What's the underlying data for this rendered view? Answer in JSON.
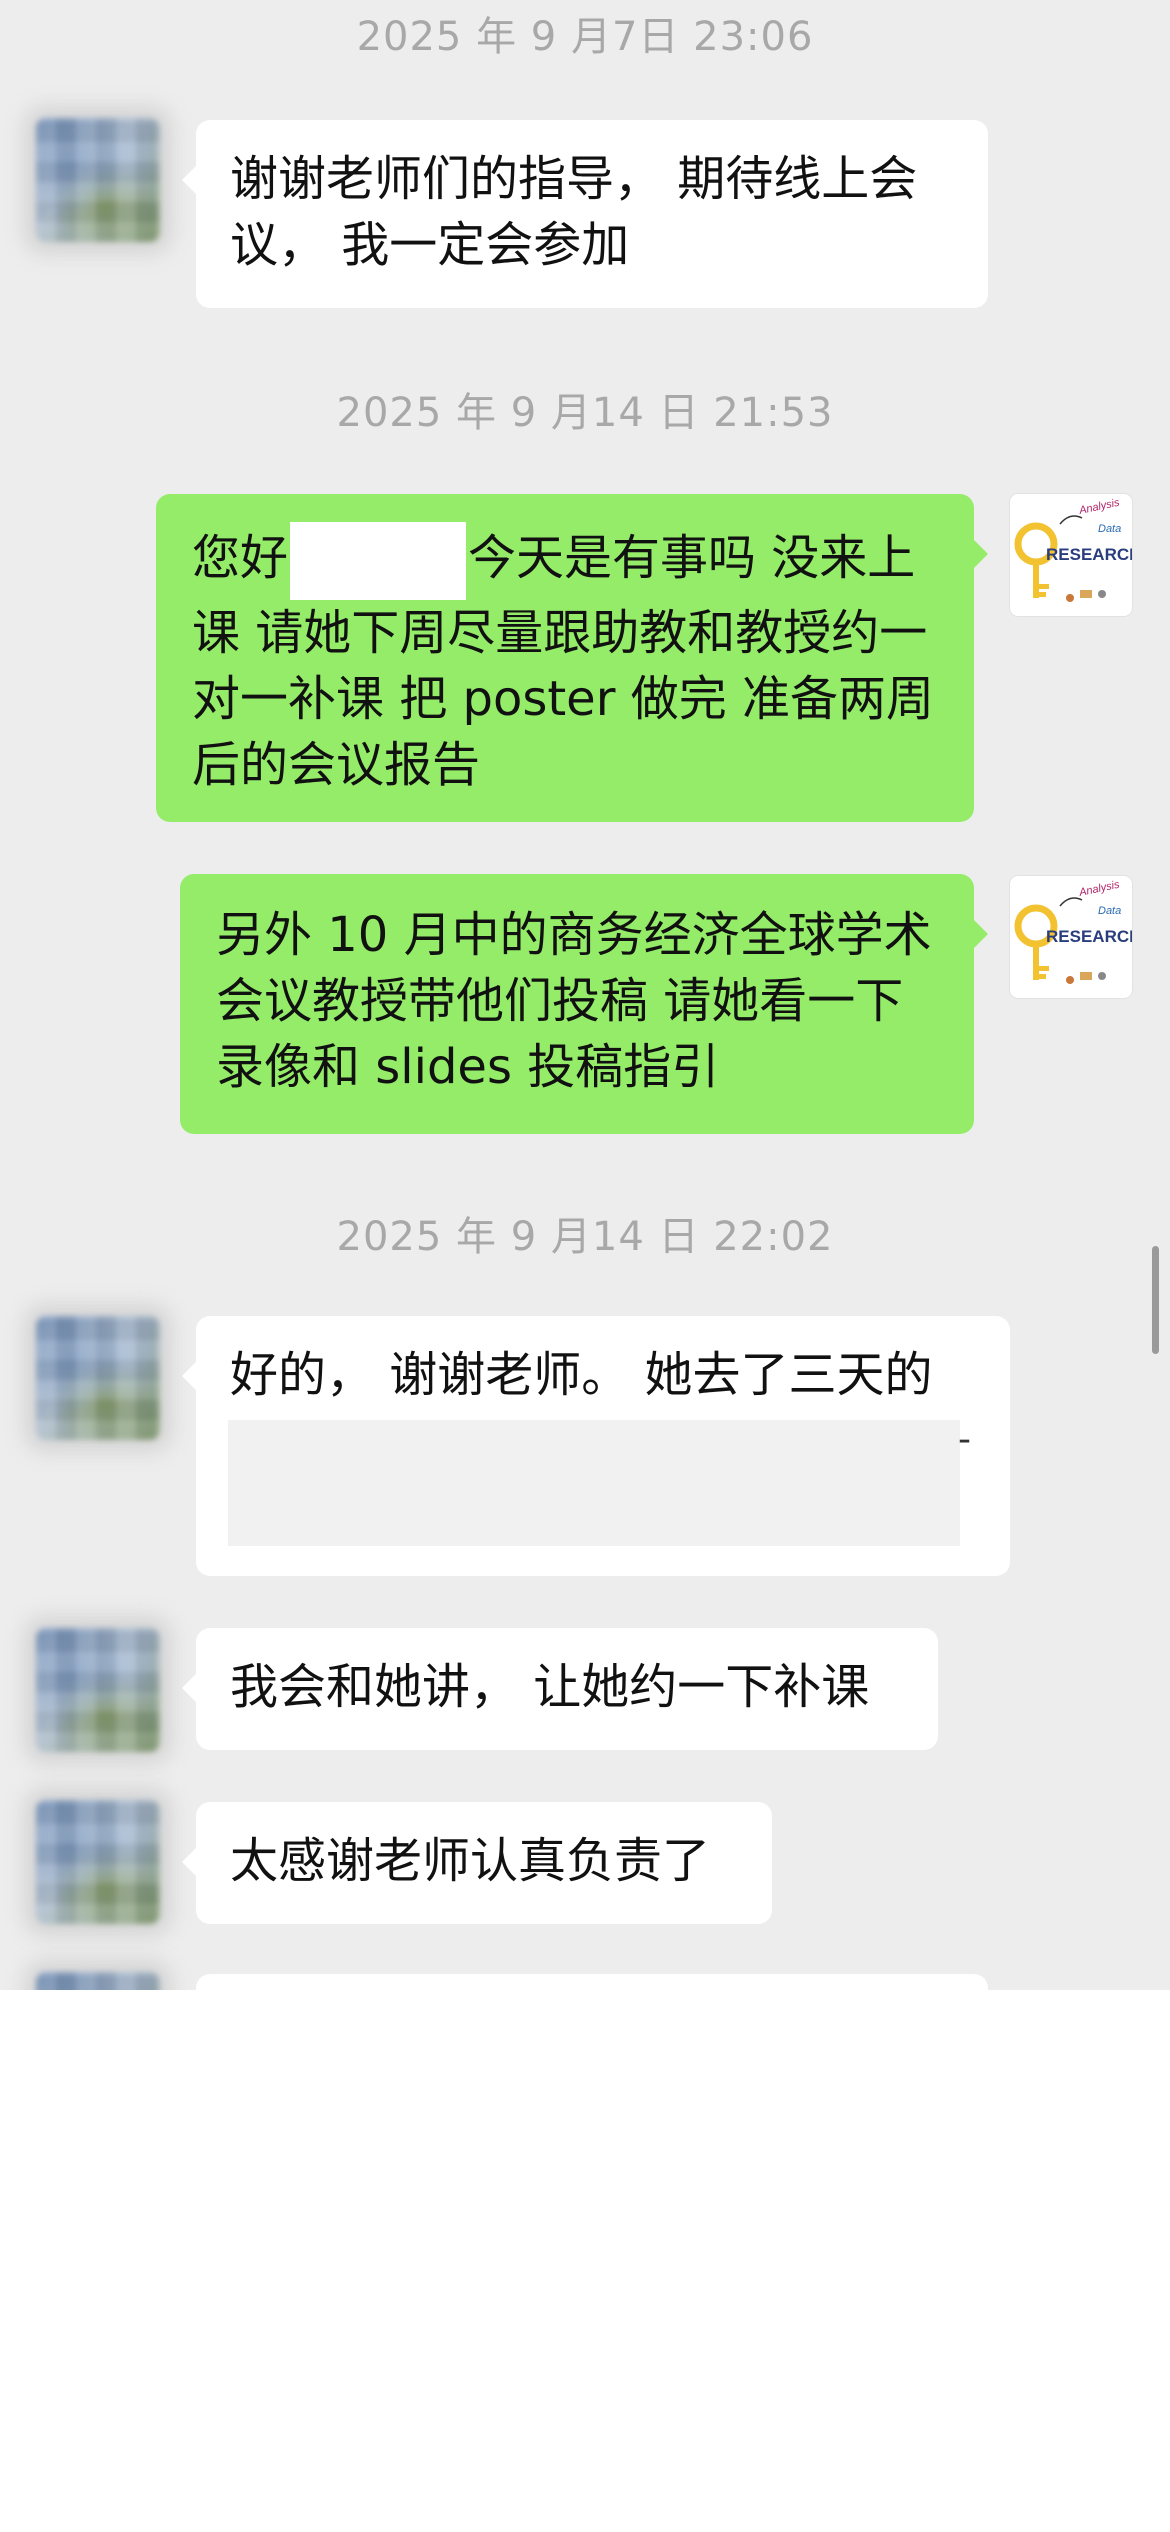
{
  "timestamps": [
    "2025 年 9 月7日 23:06",
    "2025 年 9 月14 日 21:53",
    "2025 年 9 月14 日 22:02"
  ],
  "messages": {
    "m1": "谢谢老师们的指导， 期待线上会议， 我一定会参加",
    "m2_prefix": "您好",
    "m2_rest": "今天是有事吗 没来上课 请她下周尽量跟助教和教授约一对一补课 把 poster 做完 准备两周后的会议报告",
    "m3": "另外 10 月中的商务经济全球学术会议教授带他们投稿 请她看一下录像和 slides 投稿指引",
    "m4": "好的， 谢谢老师。 她去了三天的",
    "m4_trail": "-",
    "m5": "我会和她讲， 让她约一下补课",
    "m6": "太感谢老师认真负责了"
  },
  "research_avatar": {
    "main_text": "RESEARCH",
    "tag1": "Analysis",
    "tag2": "Data"
  },
  "colors": {
    "chat_background": "#ededed",
    "incoming_bubble": "#ffffff",
    "outgoing_bubble": "#95ec69",
    "timestamp_text": "#a8a8a8"
  }
}
